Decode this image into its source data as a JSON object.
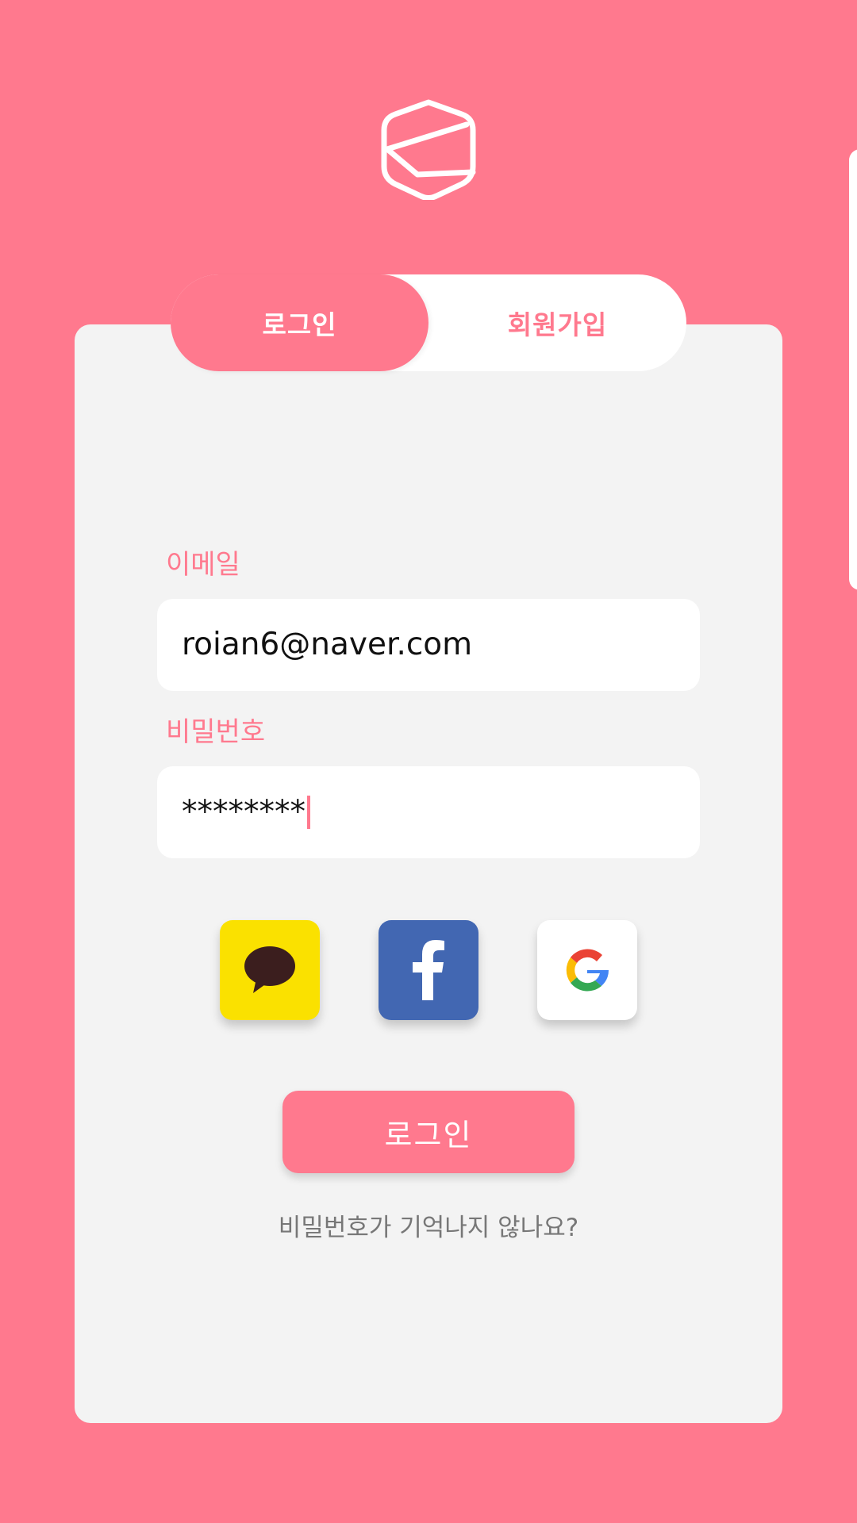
{
  "tabs": {
    "login": "로그인",
    "signup": "회원가입"
  },
  "form": {
    "email_label": "이메일",
    "email_value": "roian6@naver.com",
    "password_label": "비밀번호",
    "password_value": "********"
  },
  "social": {
    "kakao": "kakao-talk-icon",
    "facebook": "facebook-icon",
    "google": "google-icon"
  },
  "login_button": "로그인",
  "forgot_link": "비밀번호가 기억나지 않나요?",
  "colors": {
    "primary": "#ff798e",
    "card": "#f3f3f3",
    "kakao": "#fae100",
    "facebook": "#4267b2"
  }
}
